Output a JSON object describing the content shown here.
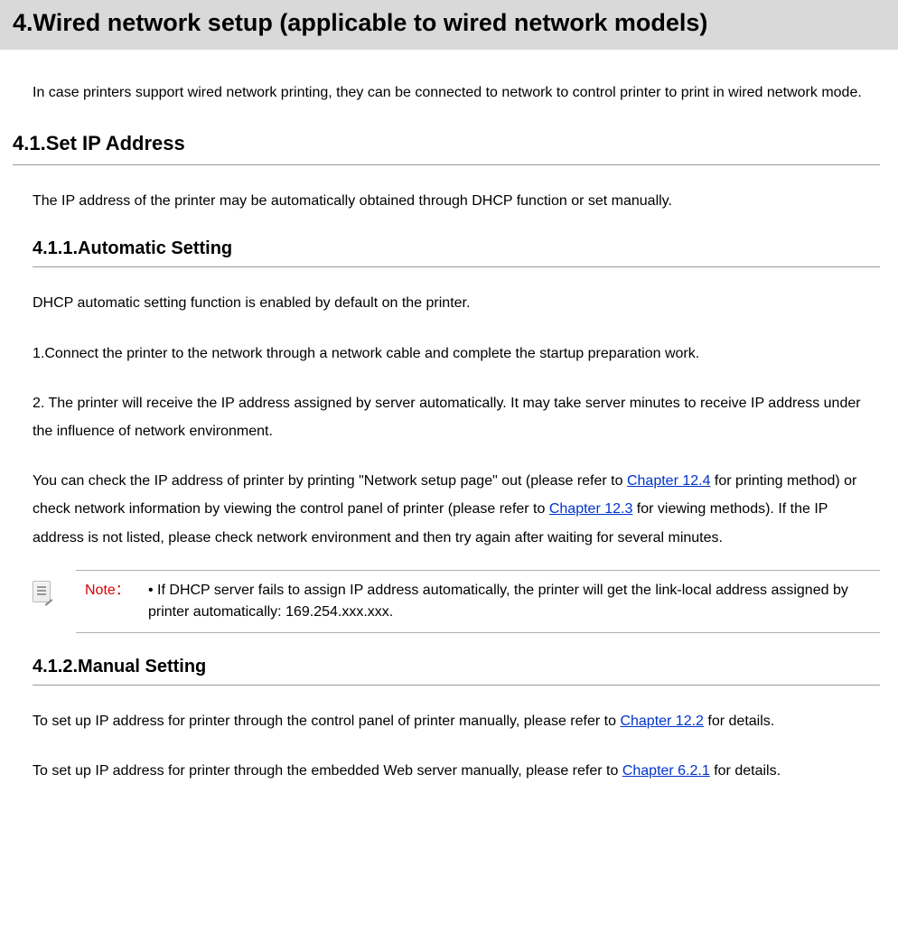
{
  "chapter": {
    "title": "4.Wired network setup (applicable to wired network models)",
    "intro": "In case printers support wired network printing, they can be connected to network to control printer to print in wired network mode."
  },
  "section41": {
    "heading": "4.1.Set IP Address",
    "intro": "The IP address of the printer may be automatically obtained through DHCP function or set manually."
  },
  "section411": {
    "heading": "4.1.1.Automatic Setting",
    "p1": "DHCP automatic setting function is enabled by default on the printer.",
    "p2": "1.Connect the printer to the network through a network cable and complete the startup preparation work.",
    "p3": "2. The printer will receive the IP address assigned by server automatically. It may take server minutes to receive IP address under the influence of network environment.",
    "p4a": "You can check the IP address of printer by printing \"Network setup page\" out (please refer to ",
    "link1": "Chapter 12.4",
    "p4b": " for printing method) or check network information by viewing the control panel of printer (please refer to ",
    "link2": "Chapter 12.3",
    "p4c": " for viewing methods). If the IP address is not listed, please check network environment and then try again after waiting for several minutes.",
    "note_label": "Note：",
    "note_text": "• If DHCP server fails to assign IP address automatically, the printer will get the link-local address assigned by printer automatically: 169.254.xxx.xxx."
  },
  "section412": {
    "heading": "4.1.2.Manual Setting",
    "p1a": "To set up IP address for printer through the control panel of printer manually, please refer to ",
    "link1": "Chapter 12.2",
    "p1b": " for details.",
    "p2a": "To set up IP address for printer through the embedded Web server manually, please refer to ",
    "link2": "Chapter 6.2.1",
    "p2b": " for details."
  }
}
